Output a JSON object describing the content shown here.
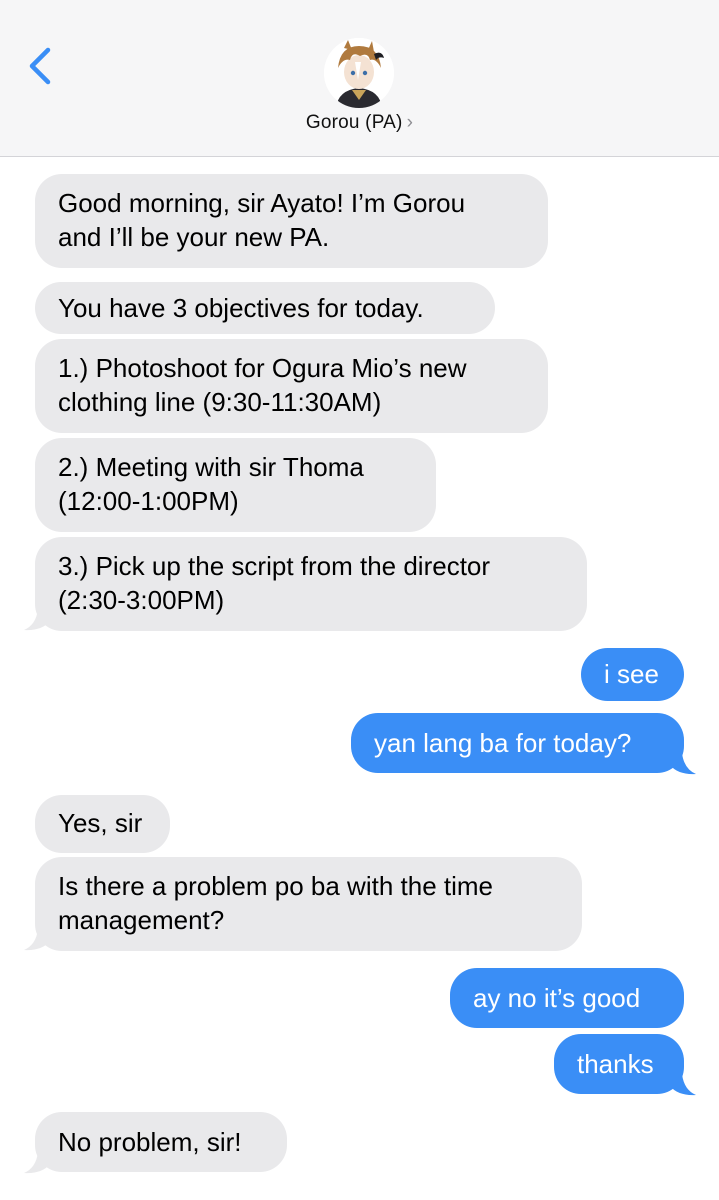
{
  "header": {
    "contact_name": "Gorou (PA)",
    "chevron": "›",
    "back_icon": "chevron-left-icon",
    "accent_color": "#3a8ef6"
  },
  "messages": [
    {
      "direction": "incoming",
      "lines": [
        "Good morning, sir Ayato! I’m Gorou",
        "and I’ll be your new PA."
      ]
    },
    {
      "direction": "incoming",
      "lines": [
        "You have 3 objectives for today."
      ]
    },
    {
      "direction": "incoming",
      "lines": [
        "1.) Photoshoot for Ogura Mio’s new",
        "clothing line (9:30-11:30AM)"
      ]
    },
    {
      "direction": "incoming",
      "lines": [
        "2.) Meeting with sir Thoma",
        "(12:00-1:00PM)"
      ]
    },
    {
      "direction": "incoming",
      "lines": [
        "3.) Pick up the script from the director",
        "(2:30-3:00PM)"
      ]
    },
    {
      "direction": "outgoing",
      "lines": [
        "i see"
      ]
    },
    {
      "direction": "outgoing",
      "lines": [
        "yan lang ba for today?"
      ]
    },
    {
      "direction": "incoming",
      "lines": [
        "Yes, sir"
      ]
    },
    {
      "direction": "incoming",
      "lines": [
        "Is there a problem po ba with the time",
        "management?"
      ]
    },
    {
      "direction": "outgoing",
      "lines": [
        "ay no it’s good"
      ]
    },
    {
      "direction": "outgoing",
      "lines": [
        "thanks"
      ]
    },
    {
      "direction": "incoming",
      "lines": [
        "No problem, sir!"
      ]
    }
  ]
}
